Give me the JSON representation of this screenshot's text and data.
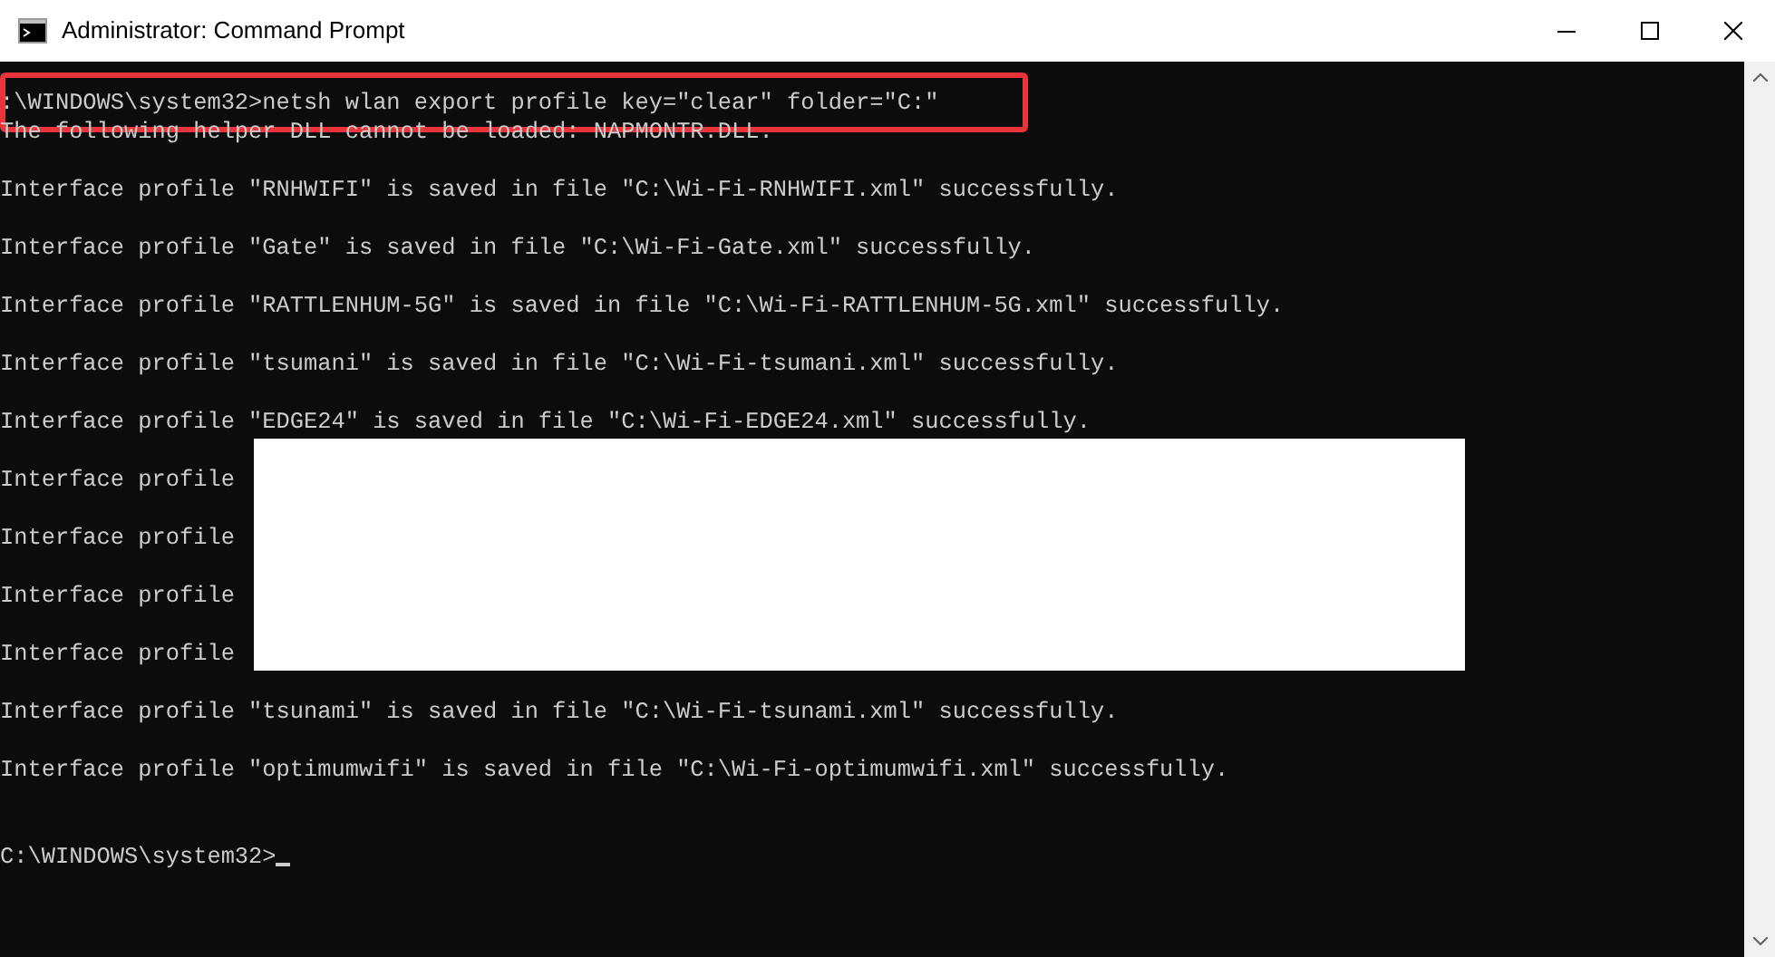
{
  "window": {
    "title": "Administrator: Command Prompt"
  },
  "lines": [
    {
      "kind": "command",
      "text": ":\\WINDOWS\\system32>netsh wlan export profile key=\"clear\" folder=\"C:\"",
      "highlighted": true
    },
    {
      "kind": "message",
      "text": "The following helper DLL cannot be loaded: NAPMONTR.DLL."
    },
    {
      "kind": "result",
      "text": "Interface profile \"RNHWIFI\" is saved in file \"C:\\Wi-Fi-RNHWIFI.xml\" successfully."
    },
    {
      "kind": "result",
      "text": "Interface profile \"Gate\" is saved in file \"C:\\Wi-Fi-Gate.xml\" successfully."
    },
    {
      "kind": "result",
      "text": "Interface profile \"RATTLENHUM-5G\" is saved in file \"C:\\Wi-Fi-RATTLENHUM-5G.xml\" successfully."
    },
    {
      "kind": "result",
      "text": "Interface profile \"tsumani\" is saved in file \"C:\\Wi-Fi-tsumani.xml\" successfully."
    },
    {
      "kind": "result",
      "text": "Interface profile \"EDGE24\" is saved in file \"C:\\Wi-Fi-EDGE24.xml\" successfully."
    },
    {
      "kind": "result",
      "text": "Interface profile",
      "redacted": true
    },
    {
      "kind": "result",
      "text": "Interface profile",
      "redacted": true
    },
    {
      "kind": "result",
      "text": "Interface profile",
      "redacted": true
    },
    {
      "kind": "result",
      "text": "Interface profile",
      "redacted": true
    },
    {
      "kind": "result",
      "text": "Interface profile \"tsunami\" is saved in file \"C:\\Wi-Fi-tsunami.xml\" successfully."
    },
    {
      "kind": "result",
      "text": "Interface profile \"optimumwifi\" is saved in file \"C:\\Wi-Fi-optimumwifi.xml\" successfully."
    },
    {
      "kind": "prompt",
      "text": "C:\\WINDOWS\\system32>",
      "cursor": true
    }
  ]
}
